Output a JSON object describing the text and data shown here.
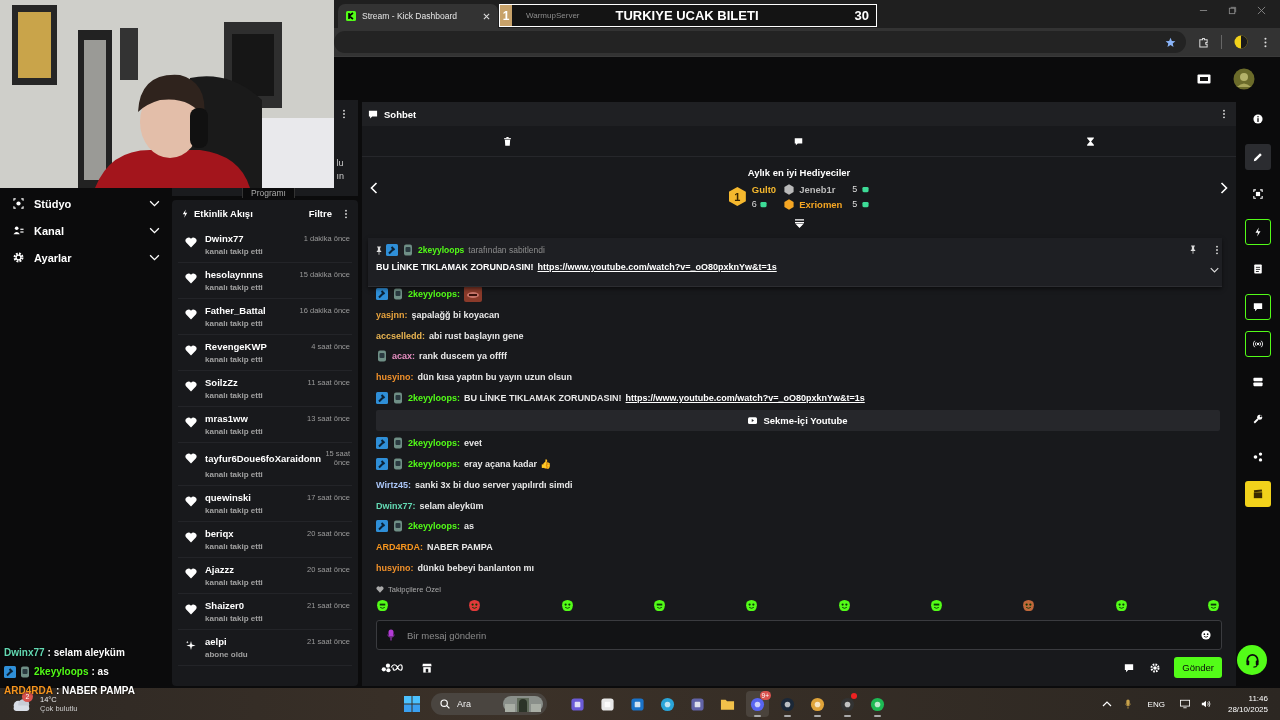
{
  "browser": {
    "tabs": [
      {
        "title": "Stream - Kick Dashboard",
        "selected": true
      }
    ],
    "overlay_banner": {
      "rank": "1",
      "tab_behind": "WarmupServer",
      "title": "TURKIYE UCAK BILETI",
      "count": "30"
    }
  },
  "stream_panel": {
    "tab": "Programı",
    "fragments": [
      "lu",
      "ın"
    ]
  },
  "sidebar": {
    "items": [
      {
        "kind": "studio",
        "label": "Stüdyo",
        "expanded": false
      },
      {
        "kind": "channel",
        "label": "Kanal",
        "expanded": false
      },
      {
        "kind": "settings",
        "label": "Ayarlar",
        "expanded": false
      }
    ]
  },
  "event_feed": {
    "title": "Etkinlik Akışı",
    "filter": "Filtre",
    "events": [
      {
        "kind": "follow",
        "name": "Dwinx77",
        "action": "kanalı takip etti",
        "time": "1 dakika önce"
      },
      {
        "kind": "follow",
        "name": "hesolaynnns",
        "action": "kanalı takip etti",
        "time": "15 dakika önce"
      },
      {
        "kind": "follow",
        "name": "Father_Battal",
        "action": "kanalı takip etti",
        "time": "16 dakika önce"
      },
      {
        "kind": "follow",
        "name": "RevengeKWP",
        "action": "kanalı takip etti",
        "time": "4 saat önce"
      },
      {
        "kind": "follow",
        "name": "SoilzZz",
        "action": "kanalı takip etti",
        "time": "11 saat önce"
      },
      {
        "kind": "follow",
        "name": "mras1ww",
        "action": "kanalı takip etti",
        "time": "13 saat önce"
      },
      {
        "kind": "follow",
        "name": "tayfur6Doue6foXaraidonn",
        "action": "kanalı takip etti",
        "time": "15 saat önce"
      },
      {
        "kind": "follow",
        "name": "quewinski",
        "action": "kanalı takip etti",
        "time": "17 saat önce"
      },
      {
        "kind": "follow",
        "name": "beriqx",
        "action": "kanalı takip etti",
        "time": "20 saat önce"
      },
      {
        "kind": "follow",
        "name": "Ajazzz",
        "action": "kanalı takip etti",
        "time": "20 saat önce"
      },
      {
        "kind": "follow",
        "name": "Shaizer0",
        "action": "kanalı takip etti",
        "time": "21 saat önce"
      },
      {
        "kind": "subscribe",
        "name": "aelpi",
        "action": "abone oldu",
        "time": "21 saat önce"
      }
    ]
  },
  "chat": {
    "title": "Sohbet",
    "leaderboard": {
      "title": "Aylık en iyi Hediyeciler",
      "top": {
        "rank": "1",
        "name": "Gult0",
        "count": "6",
        "color": "#f5b82e"
      },
      "others": [
        {
          "name": "Jeneb1r",
          "count": "5",
          "color": "#b9b9b9"
        },
        {
          "name": "Exriomen",
          "count": "5",
          "color": "#f5a623"
        }
      ]
    },
    "pinned": {
      "author": "2keyyloops",
      "note": "tarafından sabitlendi",
      "text": "BU LİNKE TIKLAMAK ZORUNDASIN!",
      "link": "https://www.youtube.com/watch?v=_oO80pxknYw&t=1s"
    },
    "messages": [
      {
        "kind": "message",
        "user": "2keyyloops:",
        "color": "#53fc18",
        "mod": true,
        "sub": true,
        "emote": true
      },
      {
        "kind": "message",
        "user": "yasjnn:",
        "color": "#e8a33d",
        "mod": false,
        "sub": false,
        "text": "şapalağğ bi koyacan"
      },
      {
        "kind": "message",
        "user": "accselledd:",
        "color": "#e9b451",
        "mod": false,
        "sub": false,
        "text": "abi rust başlayın gene"
      },
      {
        "kind": "message",
        "user": "acax:",
        "color": "#e58ec0",
        "mod": false,
        "sub": true,
        "text": "rank duscem ya offff"
      },
      {
        "kind": "message",
        "user": "husyino:",
        "color": "#f0902a",
        "mod": false,
        "sub": false,
        "text": "dün kısa yaptın bu yayın uzun olsun"
      },
      {
        "kind": "message",
        "user": "2keyyloops:",
        "color": "#53fc18",
        "mod": true,
        "sub": true,
        "text": "BU LİNKE TIKLAMAK ZORUNDASIN!",
        "link": "https://www.youtube.com/watch?v=_oO80pxknYw&t=1s"
      },
      {
        "kind": "embed",
        "label": "Sekme-İçi Youtube"
      },
      {
        "kind": "message",
        "user": "2keyyloops:",
        "color": "#53fc18",
        "mod": true,
        "sub": true,
        "text": "evet"
      },
      {
        "kind": "message",
        "user": "2keyyloops:",
        "color": "#53fc18",
        "mod": true,
        "sub": true,
        "text": "eray açana kadar 👍"
      },
      {
        "kind": "message",
        "user": "Wirtz45:",
        "color": "#a9c4f5",
        "mod": false,
        "sub": false,
        "text": "sanki 3x bi duo server yapılırdı simdi"
      },
      {
        "kind": "message",
        "user": "Dwinx77:",
        "color": "#63d9b3",
        "mod": false,
        "sub": false,
        "text": "selam aleyküm"
      },
      {
        "kind": "message",
        "user": "2keyyloops:",
        "color": "#53fc18",
        "mod": true,
        "sub": true,
        "text": "as"
      },
      {
        "kind": "message",
        "user": "ARD4RDA:",
        "color": "#f5941e",
        "mod": false,
        "sub": false,
        "text": "NABER PAMPA"
      },
      {
        "kind": "message",
        "user": "husyino:",
        "color": "#f0902a",
        "mod": false,
        "sub": false,
        "text": "dünkü bebeyi banlanton mı"
      }
    ],
    "followers_only": "Takipçilere Özel",
    "input": {
      "placeholder": "Bir mesaj gönderin"
    },
    "send": "Gönder"
  },
  "rail": [
    {
      "kind": "info",
      "selected": false,
      "active": false
    },
    {
      "kind": "pencil",
      "selected": true,
      "active": false
    },
    {
      "kind": "scan",
      "selected": false,
      "active": false
    },
    {
      "kind": "lightning",
      "selected": false,
      "active": true
    },
    {
      "kind": "document",
      "selected": false,
      "active": false
    },
    {
      "kind": "chat",
      "selected": false,
      "active": true
    },
    {
      "kind": "broadcast",
      "selected": false,
      "active": true
    },
    {
      "kind": "video",
      "selected": false,
      "active": false
    },
    {
      "kind": "wrench",
      "selected": false,
      "active": false
    },
    {
      "kind": "share",
      "selected": false,
      "active": false
    },
    {
      "kind": "clapper",
      "selected": false,
      "active": false
    }
  ],
  "overlay_chat": [
    {
      "user": "Dwinx77",
      "color": "#63d9b3",
      "badges": false,
      "text": ": selam aleyküm"
    },
    {
      "user": "2keyyloops",
      "color": "#53fc18",
      "badges": true,
      "text": ": as"
    },
    {
      "user": "ARD4RDA",
      "color": "#f5941e",
      "badges": false,
      "text": ": NABER PAMPA"
    }
  ],
  "taskbar": {
    "weather": {
      "badge": "2",
      "temp": "14°C",
      "condition": "Çok bulutlu"
    },
    "search": "Ara",
    "apps": [
      {
        "kind": "m365",
        "running": false,
        "alert": false
      },
      {
        "kind": "store",
        "running": false,
        "alert": false
      },
      {
        "kind": "mail",
        "running": false,
        "alert": false
      },
      {
        "kind": "edge",
        "running": false,
        "alert": false
      },
      {
        "kind": "teams",
        "running": false,
        "alert": false
      },
      {
        "kind": "folder",
        "running": false,
        "alert": false
      },
      {
        "kind": "discord",
        "running": true,
        "badge": "9+",
        "alert": false
      },
      {
        "kind": "steam",
        "running": true,
        "alert": false
      },
      {
        "kind": "chrome",
        "running": true,
        "alert": false
      },
      {
        "kind": "obs",
        "running": true,
        "alert": true
      },
      {
        "kind": "spotify",
        "running": true,
        "alert": false
      }
    ],
    "language": "ENG",
    "time": "11:46",
    "date": "28/10/2025"
  }
}
